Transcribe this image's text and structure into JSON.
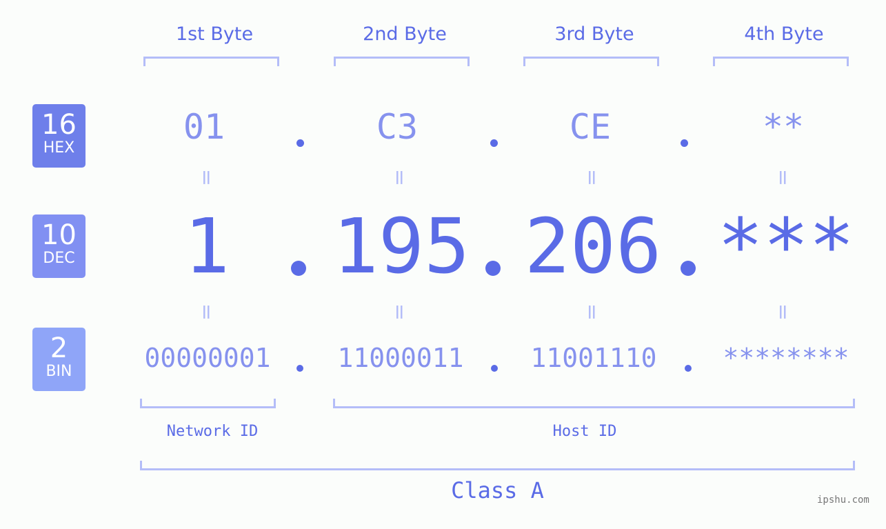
{
  "bytes": [
    {
      "label": "1st Byte",
      "hex": "01",
      "dec": "1",
      "bin": "00000001"
    },
    {
      "label": "2nd Byte",
      "hex": "C3",
      "dec": "195",
      "bin": "11000011"
    },
    {
      "label": "3rd Byte",
      "hex": "CE",
      "dec": "206",
      "bin": "11001110"
    },
    {
      "label": "4th Byte",
      "hex": "**",
      "dec": "***",
      "bin": "********"
    }
  ],
  "badges": {
    "hex": {
      "num": "16",
      "unit": "HEX",
      "color": "#6e7fea"
    },
    "dec": {
      "num": "10",
      "unit": "DEC",
      "color": "#8190f2"
    },
    "bin": {
      "num": "2",
      "unit": "BIN",
      "color": "#8fa5f8"
    }
  },
  "equals_sign": "=",
  "network_id_label": "Network ID",
  "host_id_label": "Host ID",
  "class_label": "Class A",
  "watermark": "ipshu.com",
  "colors": {
    "accent": "#5a6be6",
    "light_text": "#8692ee",
    "bracket": "#b4bdf8",
    "background": "#fbfdfb"
  }
}
